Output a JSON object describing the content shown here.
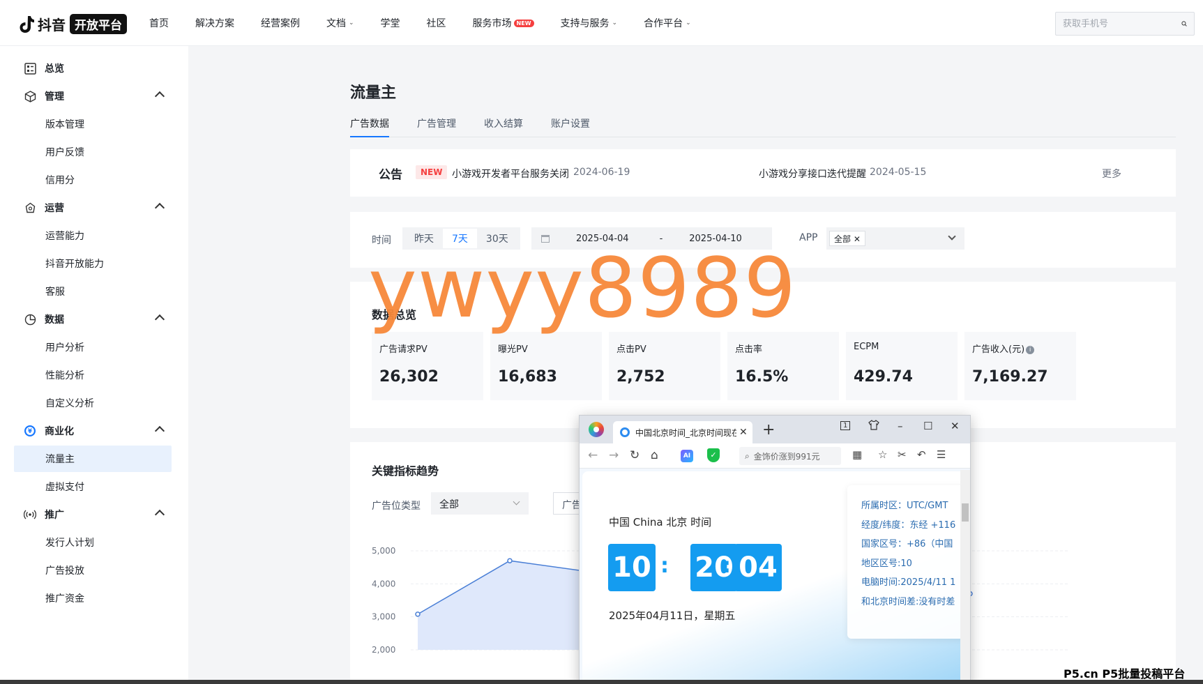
{
  "topnav": {
    "logo_text": "抖音",
    "logo_badge": "开放平台",
    "items": [
      {
        "label": "首页",
        "caret": false
      },
      {
        "label": "解决方案",
        "caret": false
      },
      {
        "label": "经营案例",
        "caret": false
      },
      {
        "label": "文档",
        "caret": true
      },
      {
        "label": "学堂",
        "caret": false
      },
      {
        "label": "社区",
        "caret": false
      },
      {
        "label": "服务市场",
        "caret": false,
        "badge": "NEW"
      },
      {
        "label": "支持与服务",
        "caret": true
      },
      {
        "label": "合作平台",
        "caret": true
      }
    ],
    "search_placeholder": "获取手机号"
  },
  "sidebar": {
    "overview": "总览",
    "groups": [
      {
        "label": "管理",
        "icon": "cube-icon",
        "items": [
          "版本管理",
          "用户反馈",
          "信用分"
        ]
      },
      {
        "label": "运营",
        "icon": "operation-icon",
        "items": [
          "运营能力",
          "抖音开放能力",
          "客服"
        ]
      },
      {
        "label": "数据",
        "icon": "pie-chart-icon",
        "items": [
          "用户分析",
          "性能分析",
          "自定义分析"
        ]
      },
      {
        "label": "商业化",
        "icon": "yen-icon",
        "items": [
          "流量主",
          "虚拟支付"
        ]
      },
      {
        "label": "推广",
        "icon": "broadcast-icon",
        "items": [
          "发行人计划",
          "广告投放",
          "推广资金"
        ]
      }
    ],
    "active_item": "流量主"
  },
  "main": {
    "title": "流量主",
    "tabs": [
      "广告数据",
      "广告管理",
      "收入结算",
      "账户设置"
    ],
    "active_tab": "广告数据"
  },
  "notice": {
    "title": "公告",
    "badge": "NEW",
    "items": [
      {
        "text": "小游戏开发者平台服务关闭",
        "date": "2024-06-19"
      },
      {
        "text": "小游戏分享接口迭代提醒",
        "date": "2024-05-15"
      }
    ],
    "more": "更多"
  },
  "filter": {
    "time_label": "时间",
    "ranges": [
      "昨天",
      "7天",
      "30天"
    ],
    "active_range": "7天",
    "date_start": "2025-04-04",
    "date_sep": "-",
    "date_end": "2025-04-10",
    "app_label": "APP",
    "app_tag": "全部 ✕"
  },
  "overview": {
    "title": "数据总览",
    "metrics": [
      {
        "label": "广告请求PV",
        "value": "26,302"
      },
      {
        "label": "曝光PV",
        "value": "16,683"
      },
      {
        "label": "点击PV",
        "value": "2,752"
      },
      {
        "label": "点击率",
        "value": "16.5%"
      },
      {
        "label": "ECPM",
        "value": "429.74"
      },
      {
        "label": "广告收入(元)",
        "value": "7,169.27",
        "info": "i"
      }
    ]
  },
  "trend": {
    "title": "关键指标趋势",
    "ad_type_label": "广告位类型",
    "ad_type_value": "全部",
    "second_select": "广告"
  },
  "chart_data": {
    "type": "line",
    "y_ticks": [
      "5,000",
      "4,000",
      "3,000",
      "2,000"
    ],
    "ylim": [
      2000,
      5000
    ],
    "series": [
      {
        "points": [
          {
            "x": 1,
            "y": 3080
          },
          {
            "x": 2,
            "y": 4700
          },
          {
            "x": 6,
            "y": 3150
          },
          {
            "x": 7,
            "y": 3700
          }
        ]
      }
    ],
    "line_color": "#4a7fd6",
    "grid": true
  },
  "watermark": "ywyy8989",
  "popup": {
    "tab_title": "中国北京时间_北京时间现在",
    "address": "金饰价涨到991元",
    "tab_count": "1",
    "city_label": "中国 China 北京 时间",
    "hours": "10",
    "minutes": "20",
    "seconds": "04",
    "colon": ":",
    "date": "2025年04月11日，星期五",
    "info_rows": [
      "所属时区：UTC/GMT",
      "经度/纬度：东经 +116",
      "国家区号：+86（中国",
      "地区区号:10",
      "电脑时间:2025/4/11 1",
      "和北京时间差:没有时差"
    ]
  },
  "corner_brand": "P5.cn P5批量投稿平台",
  "colors": {
    "accent": "#1677ff",
    "watermark": "#f7893a",
    "clock_box": "#149cf0",
    "new_badge": "#f53f3f"
  }
}
